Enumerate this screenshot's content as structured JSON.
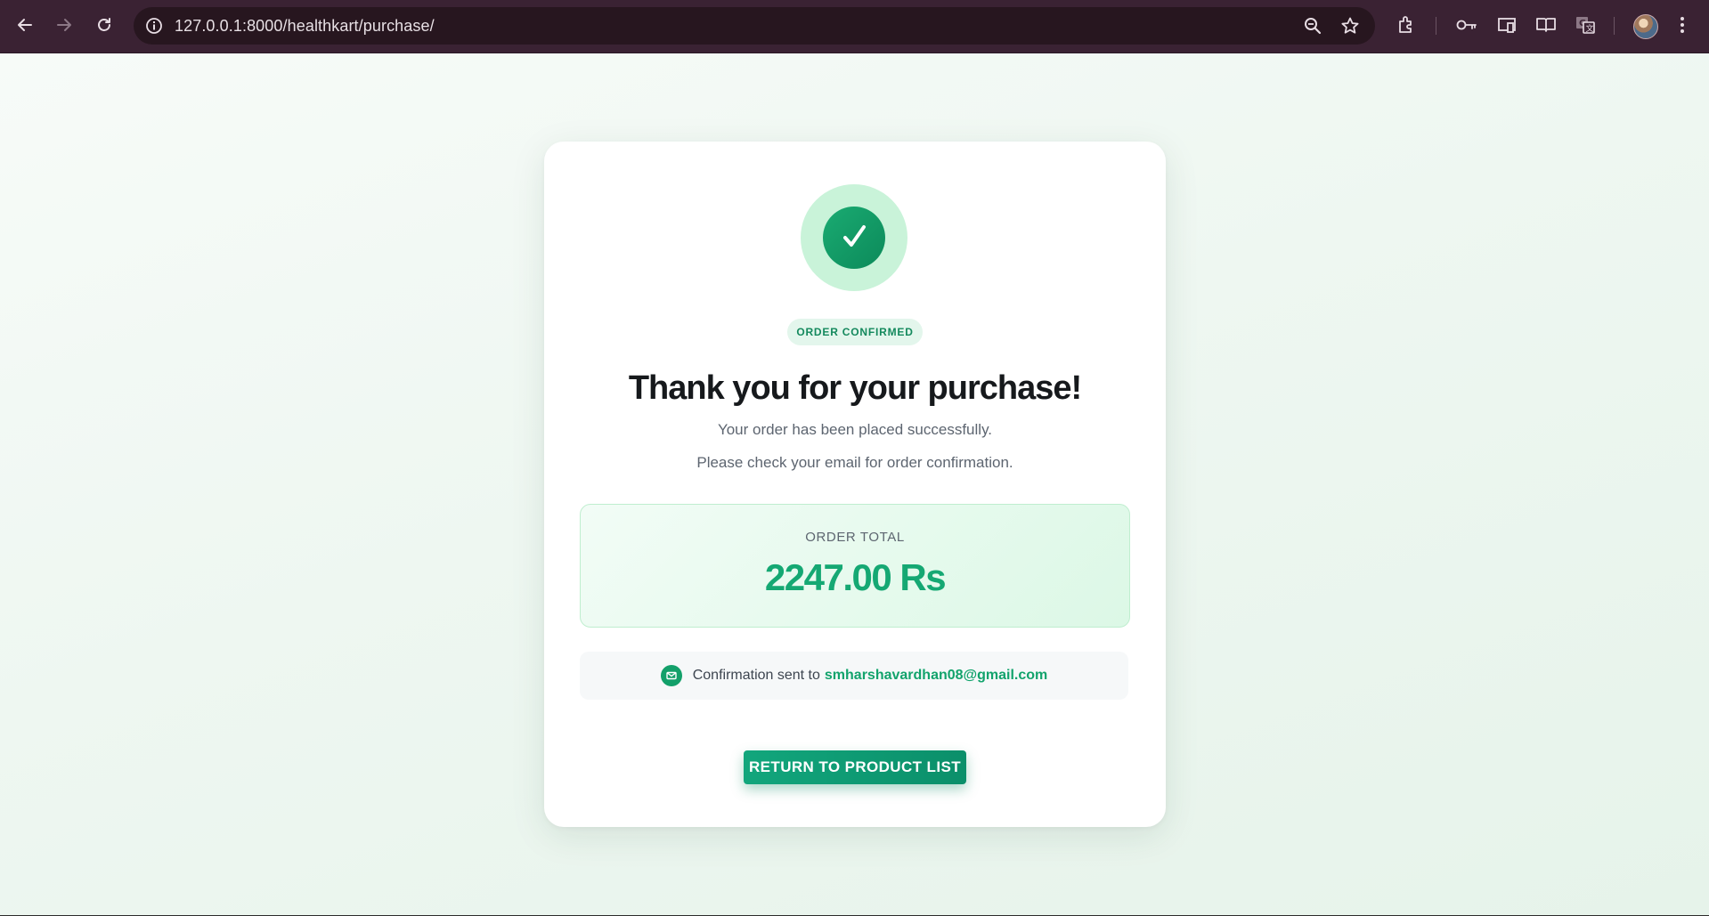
{
  "browser": {
    "url": "127.0.0.1:8000/healthkart/purchase/",
    "icons": [
      "back-arrow-icon",
      "forward-arrow-icon",
      "reload-icon",
      "site-info-icon",
      "zoom-icon",
      "bookmark-star-icon",
      "extensions-icon",
      "password-key-icon",
      "cast-icon",
      "reading-mode-icon",
      "translate-icon",
      "profile-avatar",
      "menu-icon"
    ]
  },
  "confirmation": {
    "badge": "ORDER CONFIRMED",
    "title": "Thank you for your purchase!",
    "line1": "Your order has been placed successfully.",
    "line2": "Please check your email for order confirmation.",
    "total_label": "ORDER TOTAL",
    "total_amount": "2247.00 Rs",
    "email_prefix": "Confirmation sent to",
    "email": "smharshavardhan08@gmail.com",
    "button_label": "RETURN TO PRODUCT LIST"
  },
  "colors": {
    "accent": "#15a873",
    "chrome_bg": "#3a2233",
    "badge_bg": "#e3f6ec"
  }
}
